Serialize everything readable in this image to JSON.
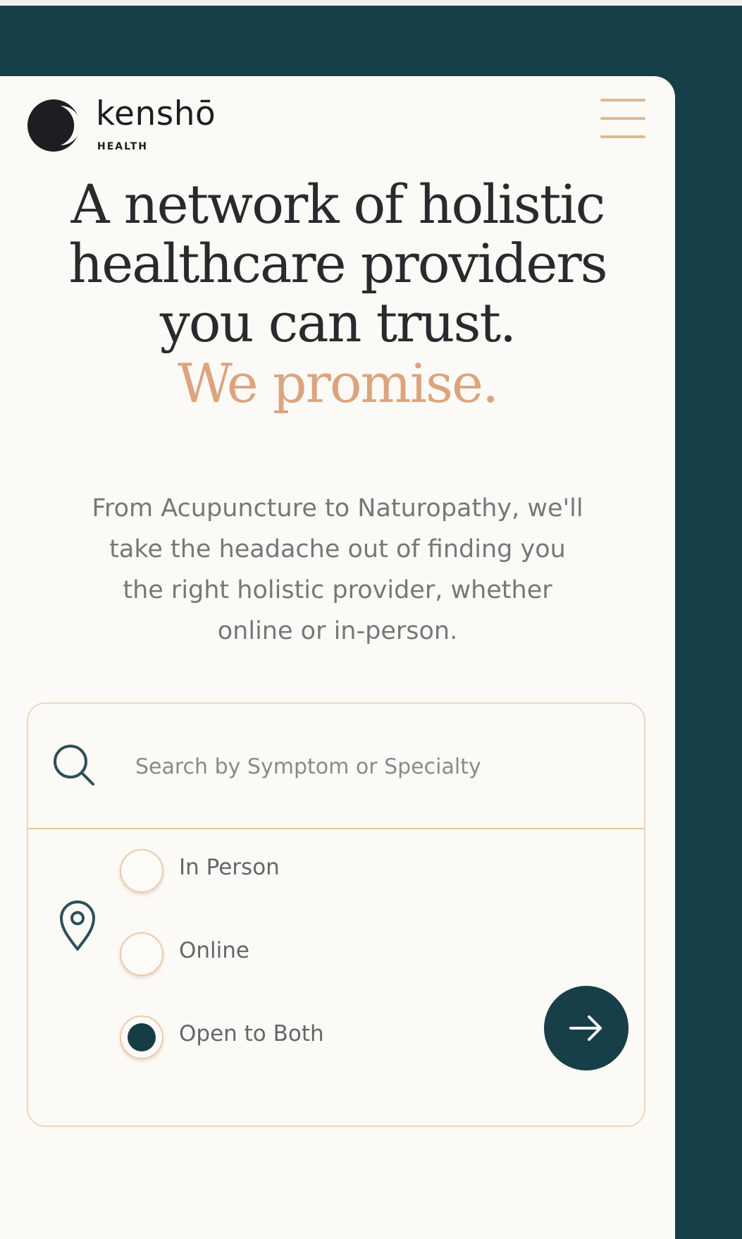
{
  "brand": {
    "name": "kenshō",
    "subtitle": "HEALTH"
  },
  "hero": {
    "line1": "A  network of holistic",
    "line2": "healthcare providers",
    "line3": "you can trust.",
    "accent": "We promise."
  },
  "description": {
    "line1": "From Acupuncture to Naturopathy, we'll",
    "line2": "take the headache out of finding you",
    "line3": "the right holistic provider, whether",
    "line4": "online or in-person."
  },
  "search": {
    "placeholder": "Search by Symptom or Specialty",
    "icon": "search-icon"
  },
  "visit_type": {
    "icon": "location-pin-icon",
    "selected": "Open to Both",
    "options": [
      {
        "label": "In Person",
        "selected": false
      },
      {
        "label": "Online",
        "selected": false
      },
      {
        "label": "Open to Both",
        "selected": true
      }
    ]
  },
  "submit": {
    "icon": "arrow-right-icon"
  },
  "colors": {
    "background": "#173f48",
    "card": "#fcfaf6",
    "accent": "#dca47e",
    "border": "#efd5bd",
    "primary_dark": "#173f48"
  }
}
